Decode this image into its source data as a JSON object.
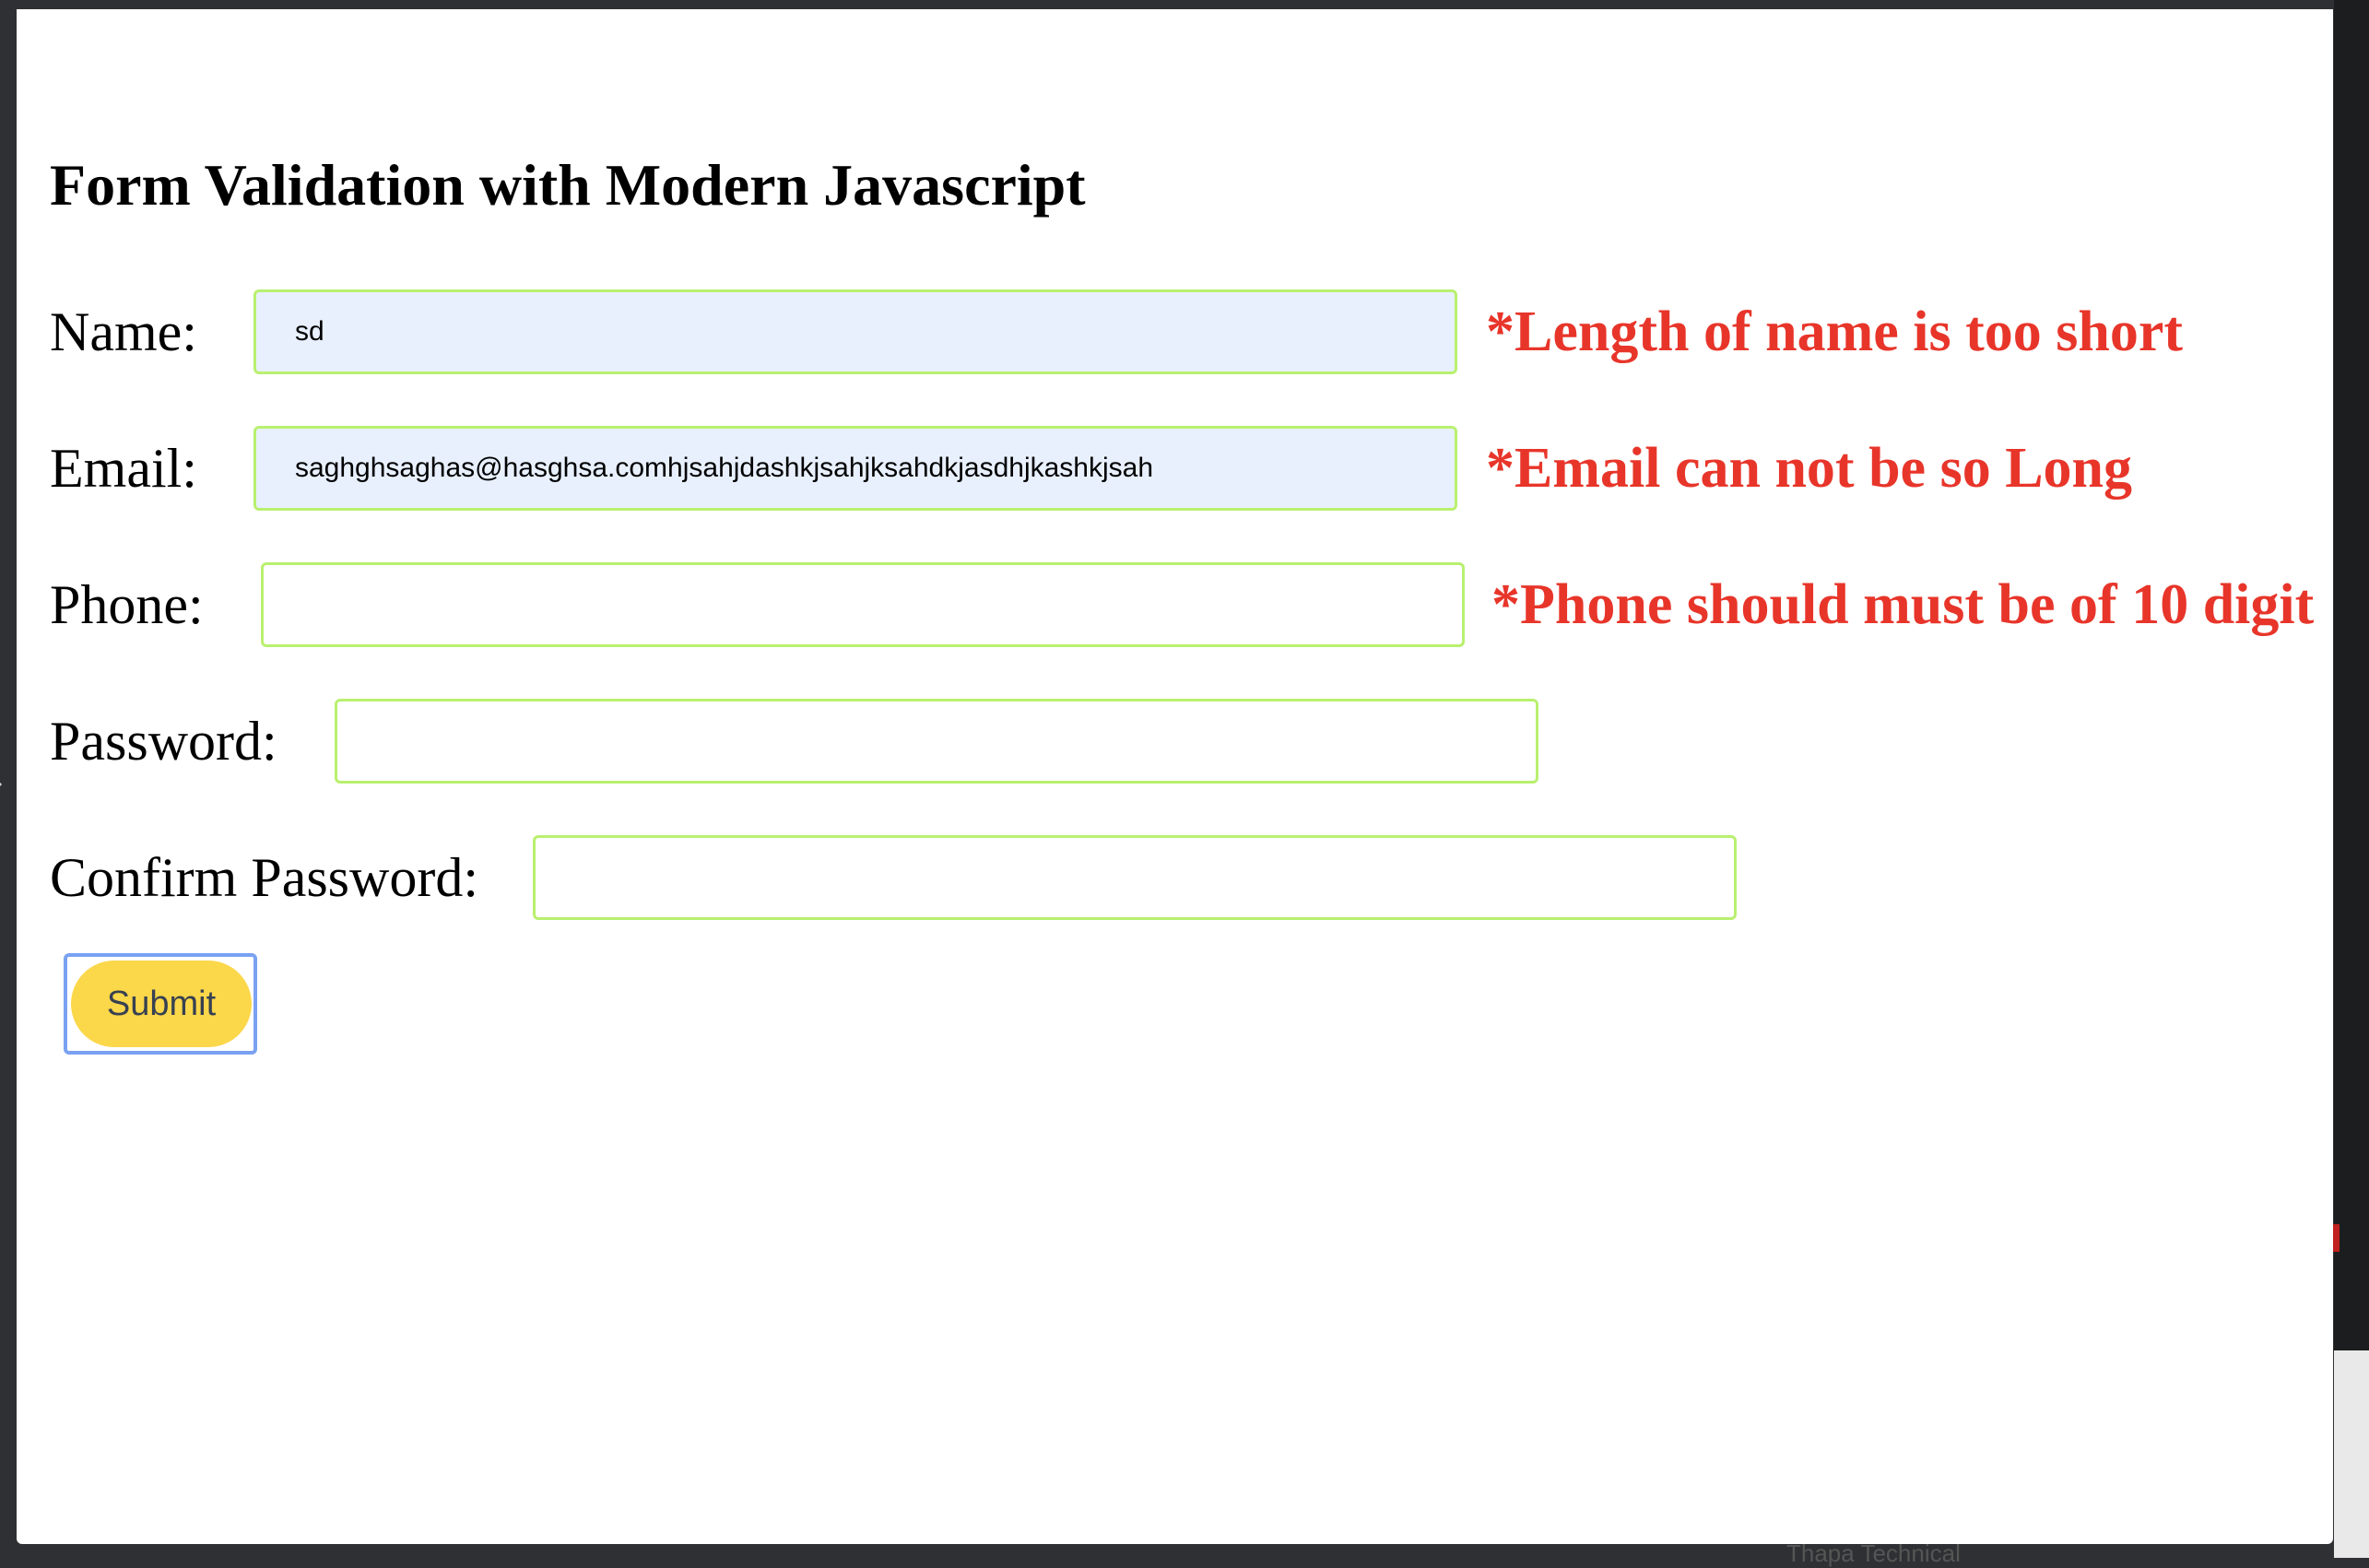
{
  "form": {
    "title": "Form Validation with Modern Javascript",
    "fields": [
      {
        "label": "Name:",
        "value": "sd",
        "error": "*Length of name is too short"
      },
      {
        "label": "Email:",
        "value": "saghghsaghas@hasghsa.comhjsahjdashkjsahjksahdkjasdhjkashkjsah",
        "error": "*Email can not be so Long"
      },
      {
        "label": "Phone:",
        "value": "",
        "error": "*Phone should must be of 10 digit"
      },
      {
        "label": "Password:",
        "value": "",
        "error": ""
      },
      {
        "label": "Confirm Password:",
        "value": "",
        "error": ""
      }
    ],
    "submit_label": "Submit"
  },
  "background": {
    "partial_text": "Thapa Technical"
  },
  "colors": {
    "error": "#e8352a",
    "field_border": "#b9f06f",
    "autofill_bg": "#e8f0fe",
    "submit_bg": "#fbd74a",
    "focus_ring": "#7aa1f2"
  }
}
